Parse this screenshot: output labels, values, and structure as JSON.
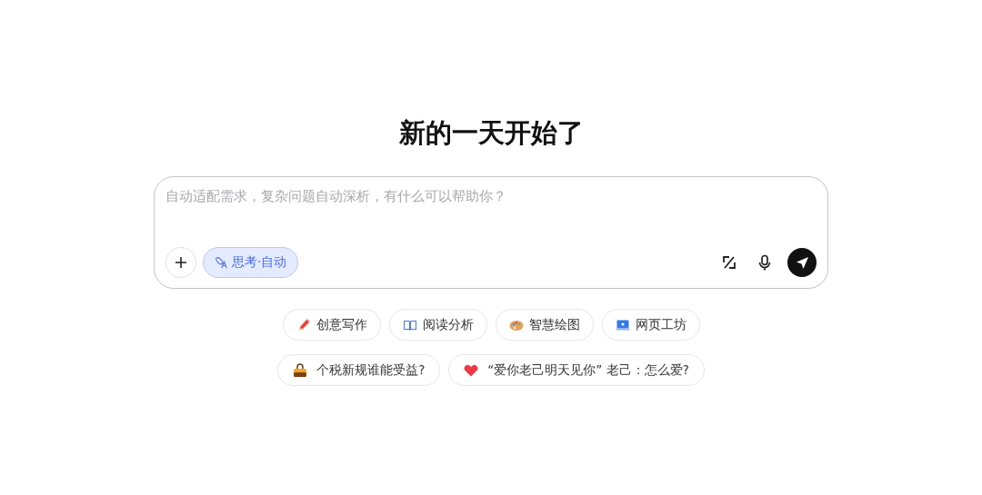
{
  "heading": "新的一天开始了",
  "composer": {
    "placeholder": "自动适配需求，复杂问题自动深析，有什么可以帮助你？",
    "think_toggle": {
      "label": "思考·自动",
      "selected": true
    }
  },
  "shortcuts": [
    {
      "kind": "pencil",
      "label": "创意写作"
    },
    {
      "kind": "book",
      "label": "阅读分析"
    },
    {
      "kind": "palette",
      "label": "智慧绘图"
    },
    {
      "kind": "laptop",
      "label": "网页工坊"
    }
  ],
  "suggestions": [
    {
      "kind": "bag",
      "label": "个税新规谁能受益?"
    },
    {
      "kind": "heart",
      "label": "“爱你老己明天见你” 老己：怎么爱?"
    }
  ]
}
